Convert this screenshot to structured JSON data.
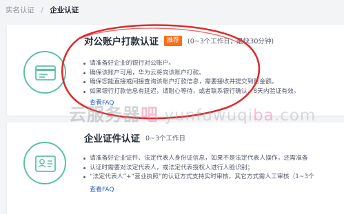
{
  "breadcrumb": {
    "parent": "实名认证",
    "separator": "/",
    "current": "企业认证"
  },
  "bank_card": {
    "title": "对公账户打款认证",
    "badge": "推荐",
    "time": "(0~3个工作日，最快30分钟)",
    "items": [
      "请准备好企业的银行对公账户。",
      "确保该账户可用，华为云将向该账户打款。",
      "确保您能直接或间接查询该账户打款信息，需要接收并提交到账金额。",
      "如果银行打款信息有延迟，请耐心等待，或者联系银行确认，8天内验证有效。"
    ],
    "faq": "查看FAQ",
    "icon": "bank-card-icon"
  },
  "license_card": {
    "title": "企业证件认证",
    "time": "0~3个工作日",
    "items": [
      "请准备好企业证件、法定代表人身份证信息，如果不是法定代表人操作，还需准备",
      "认证时需要对法定代表人，或法定代表授权人进行人脸识别；",
      "“法定代表人”+“营业执照”的认证方式支持实时审核，其它方式需人工审核（1~3个"
    ],
    "faq": "查看FAQ",
    "icon": "license-id-icon"
  },
  "watermark": {
    "part1": "云服务器",
    "part2": "吧",
    "part3": " yunfuwuqi",
    "part4": "ba",
    "part5": ".com"
  },
  "colors": {
    "accent_green": "#5cc0a5",
    "badge_orange": "#fa6d1b",
    "link_blue": "#2a63c9",
    "annotation_red": "#e02a2a"
  }
}
